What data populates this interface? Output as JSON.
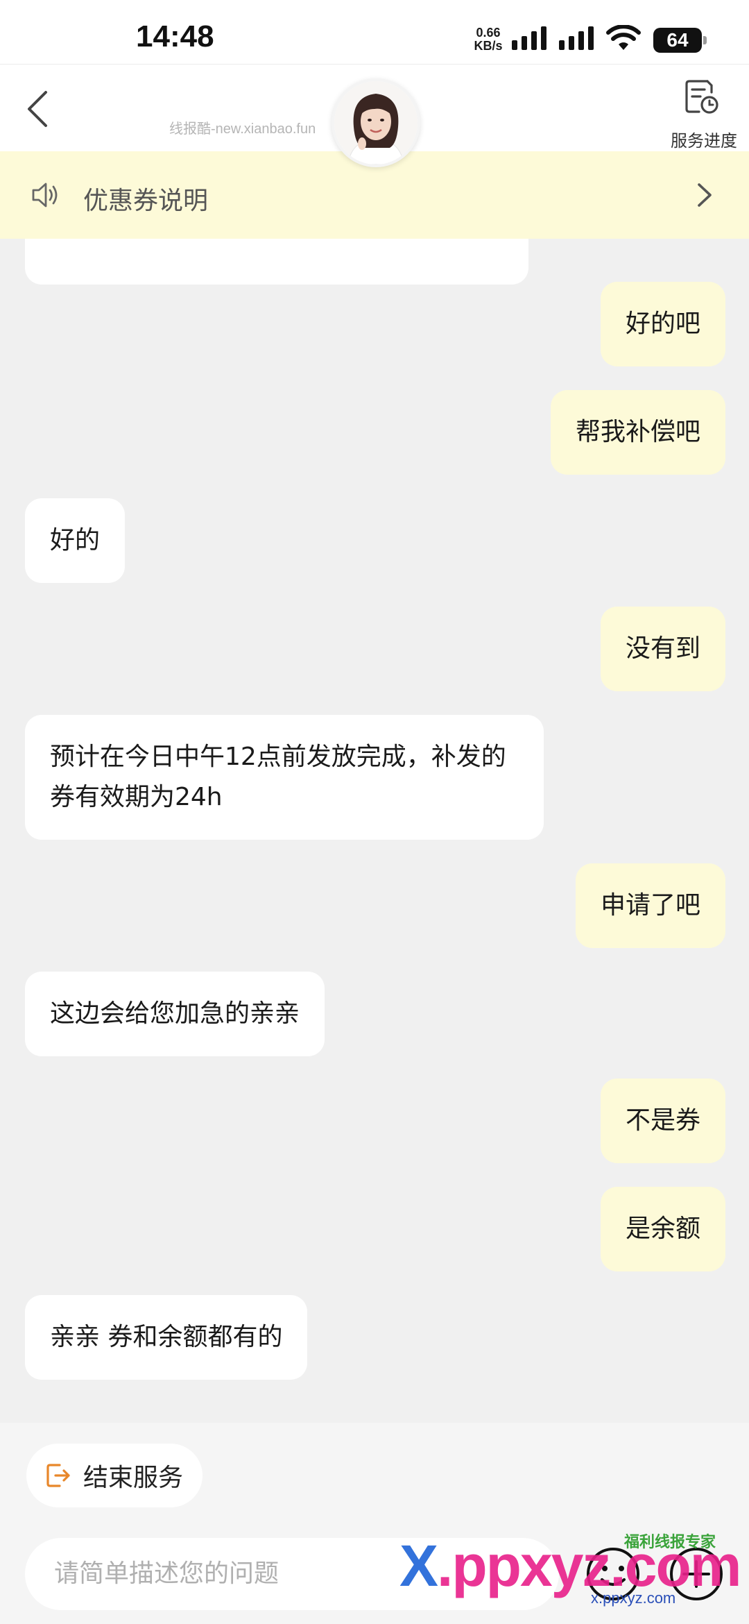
{
  "status_bar": {
    "time": "14:48",
    "net_speed_value": "0.66",
    "net_speed_unit": "KB/s",
    "battery": "64"
  },
  "header": {
    "watermark": "线报酷-new.xianbao.fun",
    "service_progress_label": "服务进度"
  },
  "notice": {
    "text": "优惠券说明"
  },
  "messages": [
    {
      "side": "user",
      "text": "好的吧"
    },
    {
      "side": "user",
      "text": "帮我补偿吧"
    },
    {
      "side": "agent",
      "text": "好的"
    },
    {
      "side": "user",
      "text": "没有到"
    },
    {
      "side": "agent",
      "text": "预计在今日中午12点前发放完成，补发的券有效期为24h"
    },
    {
      "side": "user",
      "text": "申请了吧"
    },
    {
      "side": "agent",
      "text": "这边会给您加急的亲亲"
    },
    {
      "side": "user",
      "text": "不是券"
    },
    {
      "side": "user",
      "text": "是余额"
    },
    {
      "side": "agent",
      "text": "亲亲 券和余额都有的"
    }
  ],
  "bottom": {
    "end_service_label": "结束服务",
    "input_placeholder": "请简单描述您的问题"
  },
  "watermark": {
    "logo_x": "X",
    "logo_rest": ".ppxyz.com",
    "badge": "福利线报专家",
    "url": "x.ppxyz.com"
  },
  "colors": {
    "user_bubble": "#fdfad8",
    "agent_bubble": "#ffffff",
    "chat_background": "#f0f0f0",
    "end_service_icon": "#e8872a"
  }
}
